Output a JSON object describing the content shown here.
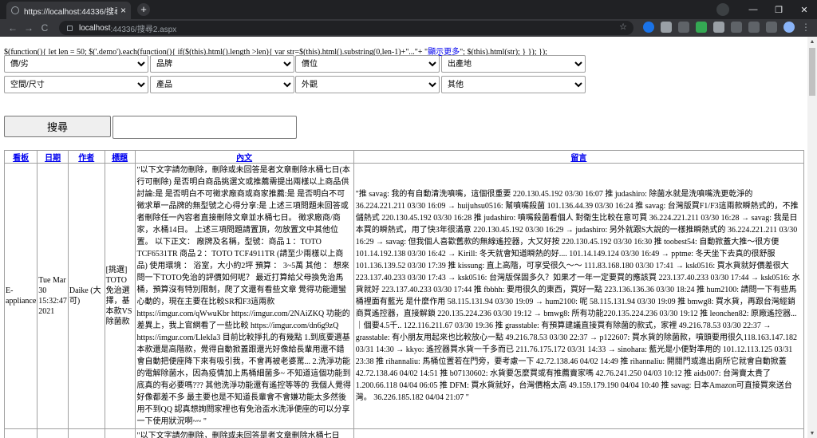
{
  "browser": {
    "tab_title": "https://localhost:44336/搜尋2.a",
    "tab_close": "×",
    "new_tab": "+",
    "url_host": "localhost",
    "url_path": ":44336/搜尋2.aspx",
    "back": "←",
    "forward": "→",
    "reload": "C",
    "star": "☆",
    "menu": "⋮",
    "window_buttons": [
      "—",
      "❐",
      "✕"
    ]
  },
  "page": {
    "script_text": "$(function(){ let len = 50; $('.demo').each(function(){ if($(this).html().length >len){ var str=$(this).html().substring(0,len-1)+\"...\"+ \"",
    "script_link": "顯示更多",
    "script_tail": "\"; $(this).html(str); } }); });",
    "filters_row1": [
      "價/劣",
      "品牌",
      "價位",
      "出產地"
    ],
    "filters_row2": [
      "空間/尺寸",
      "產品",
      "外觀",
      "其他"
    ],
    "search_button": "搜尋",
    "search_value": "",
    "table": {
      "headers": [
        "看板",
        "日期",
        "作者",
        "標題",
        "內文",
        "留言"
      ],
      "rows": [
        {
          "board": "E-appliance",
          "date": "Tue Mar 30 15:32:47 2021",
          "author": "Daike (大可)",
          "title": "[挑選] TOTO免治選擇，基本款VS除菌款",
          "content": "\"以下文字請勿刪除，刪除或未回答是者文章刪除水桶七日(本行可刪除) 是否明白商品挑選文或推薦需提出兩樣以上商品供討論:是 是否明白不可徵求廠商或商家推薦:是 是否明白不可徵求單一品牌的無型號之心得分享:是 上述三項問題未回答或者刪除任一內容者直接刪除文章並水桶七日。 徵求廠商/商家，水桶14日。 上述三項問題請置頂，勿放置文中其他位置。 以下正文： 廠牌及名稱，型號：商品１：TOTO TCF6531TR 商品２：TOTO TCF4911TR (請至少兩樣以上商品) 使用環境 ： 浴室，大小約2坪 預算 ： 3~5萬 其他 ： 想來問一下TOTO免治的評價如何呢？ 最近打算給父母換免治馬桶，預算沒有特別限制，爬了文還有看些文章 覺得功能還蠻心動的，現在主要在比較SR和F3這兩款 https://imgur.com/qWwuKbr https://imgur.com/2NAiZKQ 功能的差異上，我上官網看了一些比較 https://imgur.com/dn6g9zQ https://imgur.com/LlekIa3 目前比較掙扎的有幾點 1.到底要選基本款還是高階款，覺得自動掀蓋跟還光好像給長輩用還不錯 會自動把便座降下來有吸引我，不會再被老婆罵... 2.洗淨功能的電解除菌水，因為疫情加上馬桶細菌多~ 不知道這個功能到底真的有必要嗎??? 其他洗淨功能還有遙控等等的 我個人覺得好像都差不多 最主要也是不知道長輩會不會嫌功能太多然後用不到QQ 認真想詢問家裡也有免治盃水洗淨便座的可以分享一下使用狀況啊~~ \"",
          "comments": "\"推 savag: 我的有自動清洗噴嘴，這個很重要 220.130.45.192 03/30 16:07 推 judashiro: 除菌水就是洗噴嘴洗更乾淨的 36.224.221.211 03/30 16:09 → huijuhsu0516: 幫噴嘴殺菌 101.136.44.39 03/30 16:24 推 savag: 台灣版買F1/F3這兩款瞬熱式的，不推儲熱式 220.130.45.192 03/30 16:28 推 judashiro: 噴嘴殺菌看個人 對衛生比較在意可買 36.224.221.211 03/30 16:28 → savag: 我是日本買的瞬熱式，用了快3年很滿意 220.130.45.192 03/30 16:29 → judashiro: 另外就跟S大說的一樣推瞬熱式的 36.224.221.211 03/30 16:29 → savag: 但我個人喜歡舊款的無線遙控器，大又好按 220.130.45.192 03/30 16:30 推 toobest54: 自動掀蓋大推～很方便 101.14.192.138 03/30 16:42 → Kirill: 冬天就會知道瞬熱的好.... 101.14.149.124 03/30 16:49 → pptme: 冬天坐下去真的很舒服 101.136.139.52 03/30 17:39 推 kissung: 直上高階，可享受很久～～ 111.83.168.180 03/30 17:41 → ksk0516: 買水貨就好價差很大 223.137.40.233 03/30 17:43 → ksk0516: 台灣版保固多久？如果才一年一定要買的應該買 223.137.40.233 03/30 17:44 → ksk0516: 水貨就好 223.137.40.233 03/30 17:44 推 fbbhh: 要用很久的東西，買好一點 223.136.136.36 03/30 18:24 推 hum2100: 請問一下有些馬桶裡面有藍光 是什麼作用 58.115.131.94 03/30 19:09 → hum2100: 呢 58.115.131.94 03/30 19:09 推 bmwg8: 買水貨，再跟台灣經銷商買遙控器，直接解鎖 220.135.224.236 03/30 19:12 → bmwg8: 所有功能220.135.224.236 03/30 19:12 推 leonchen82: 原廠遙控器...｜個要4.5千.. 122.116.211.67 03/30 19:36 推 grasstable: 有預算建議直接買有除菌的款式，家裡 49.216.78.53 03/30 22:37 → grasstable: 有小朋友用起來也比較放心一點 49.216.78.53 03/30 22:37 → p122607: 買水貨的除菌款，噴頭要用很久118.163.147.182 03/31 14:30 → kkyo: 遙控器買水貨一千多而已 211.76.175.172 03/31 14:33 → sinohara: 藍光是小便對準用的 101.12.113.125 03/31 23:38 推 rihannaliu: 馬桶位置若在門旁，要考慮一下 42.72.138.46 04/02 14:49 推 rihannaliu: 開關門或進出廁所它就會自動掀蓋 42.72.138.46 04/02 14:51 推 b07130602: 水貨要怎麼買或有推薦賣家嗎 42.76.241.250 04/03 10:12 推 aids007: 台灣賣太貴了 1.200.66.118 04/04 06:05 推 DFM: 買水貨就好，台灣價格太高 49.159.179.190 04/04 10:40 推 savag: 日本Amazon可直接買來送台灣。 36.226.185.182 04/04 21:07 \""
        },
        {
          "board": "",
          "date": "",
          "author": "",
          "title": "",
          "content": "\"以下文字請勿刪除，刪除或未回答是者文章刪除水桶七日",
          "comments": ""
        }
      ]
    }
  }
}
